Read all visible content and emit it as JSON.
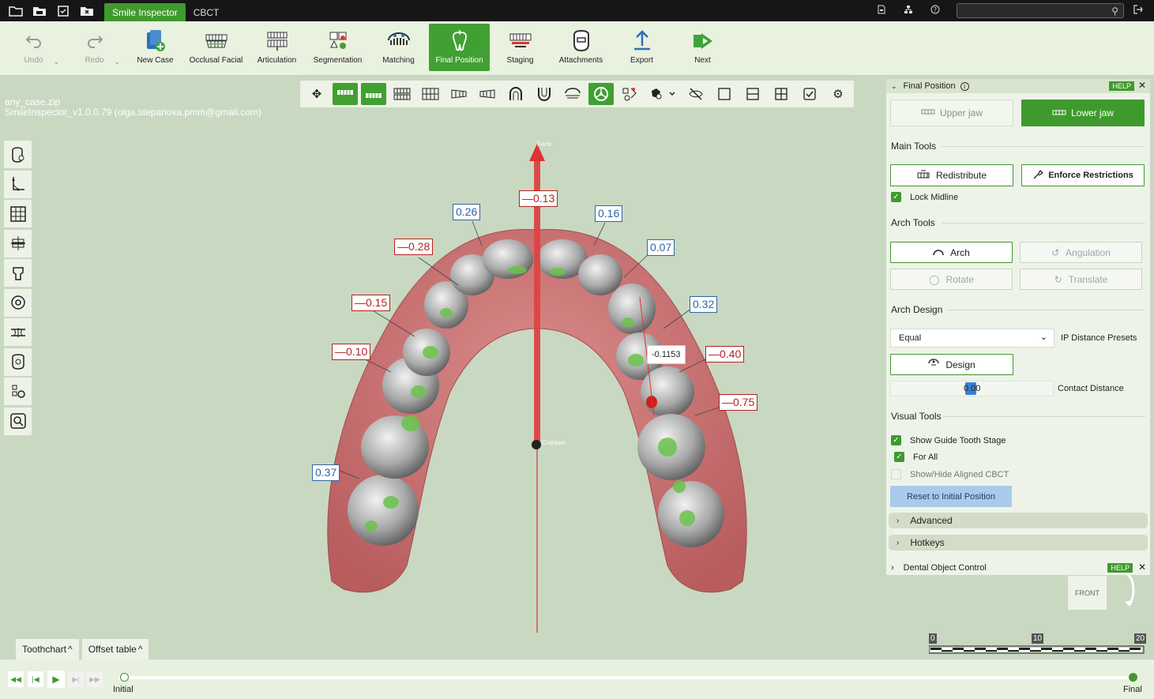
{
  "titlebar": {
    "tabs": [
      "Smile Inspector",
      "CBCT"
    ],
    "search_placeholder": ""
  },
  "toolbar": {
    "items": [
      {
        "label": "Undo",
        "icon": "undo-icon",
        "state": "disabled"
      },
      {
        "label": "Redo",
        "icon": "redo-icon",
        "state": "disabled"
      },
      {
        "label": "New Case",
        "icon": "new-case-icon",
        "state": "normal"
      },
      {
        "label": "Occlusal Facial",
        "icon": "occlusal-facial-icon",
        "state": "normal"
      },
      {
        "label": "Articulation",
        "icon": "articulation-icon",
        "state": "normal"
      },
      {
        "label": "Segmentation",
        "icon": "segmentation-icon",
        "state": "normal"
      },
      {
        "label": "Matching",
        "icon": "matching-icon",
        "state": "normal"
      },
      {
        "label": "Final Position",
        "icon": "final-position-icon",
        "state": "active"
      },
      {
        "label": "Staging",
        "icon": "staging-icon",
        "state": "normal"
      },
      {
        "label": "Attachments",
        "icon": "attachments-icon",
        "state": "normal"
      },
      {
        "label": "Export",
        "icon": "export-icon",
        "state": "normal"
      },
      {
        "label": "Next",
        "icon": "next-icon",
        "state": "normal"
      }
    ]
  },
  "viewport": {
    "file": "any_case.zip",
    "app_info": "SmileInspector_v1.0.0.79 (olga.stepanova.pmm@gmail.com)",
    "axis_top_label": "Face",
    "axis_center_label": "Cranium",
    "measurements": [
      {
        "text": "—0.13",
        "color": "red"
      },
      {
        "text": "0.26",
        "color": "blue"
      },
      {
        "text": "0.16",
        "color": "blue"
      },
      {
        "text": "—0.28",
        "color": "red"
      },
      {
        "text": "0.07",
        "color": "blue"
      },
      {
        "text": "—0.15",
        "color": "red"
      },
      {
        "text": "0.32",
        "color": "blue"
      },
      {
        "text": "—0.10",
        "color": "red"
      },
      {
        "text": "-0.1153",
        "color": "gray"
      },
      {
        "text": "—0.40",
        "color": "red"
      },
      {
        "text": "—0.75",
        "color": "red"
      },
      {
        "text": "0.37",
        "color": "blue"
      }
    ],
    "bottom_tabs": [
      "Toothchart",
      "Offset table"
    ]
  },
  "panel": {
    "title": "Final Position",
    "help": "HELP",
    "upper_jaw": "Upper jaw",
    "lower_jaw": "Lower jaw",
    "main_tools": "Main Tools",
    "redistribute": "Redistribute",
    "enforce": "Enforce Restrictions",
    "lock_midline": "Lock Midline",
    "arch_tools": "Arch Tools",
    "arch": "Arch",
    "angulation": "Angulation",
    "rotate": "Rotate",
    "translate": "Translate",
    "arch_design": "Arch Design",
    "preset_value": "Equal",
    "ip_presets": "IP Distance Presets",
    "design": "Design",
    "contact_value": "0.00",
    "contact_label": "Contact Distance",
    "visual_tools": "Visual Tools",
    "show_guide": "Show Guide Tooth Stage",
    "for_all": "For All",
    "show_cbct": "Show/Hide Aligned CBCT",
    "reset": "Reset to Initial Position",
    "advanced": "Advanced",
    "hotkeys": "Hotkeys"
  },
  "dental": {
    "title": "Dental Object Control",
    "help": "HELP"
  },
  "front_label": "FRONT",
  "scale": {
    "labels": [
      "0",
      "10",
      "20"
    ]
  },
  "timeline": {
    "start": "Initial",
    "end": "Final"
  }
}
